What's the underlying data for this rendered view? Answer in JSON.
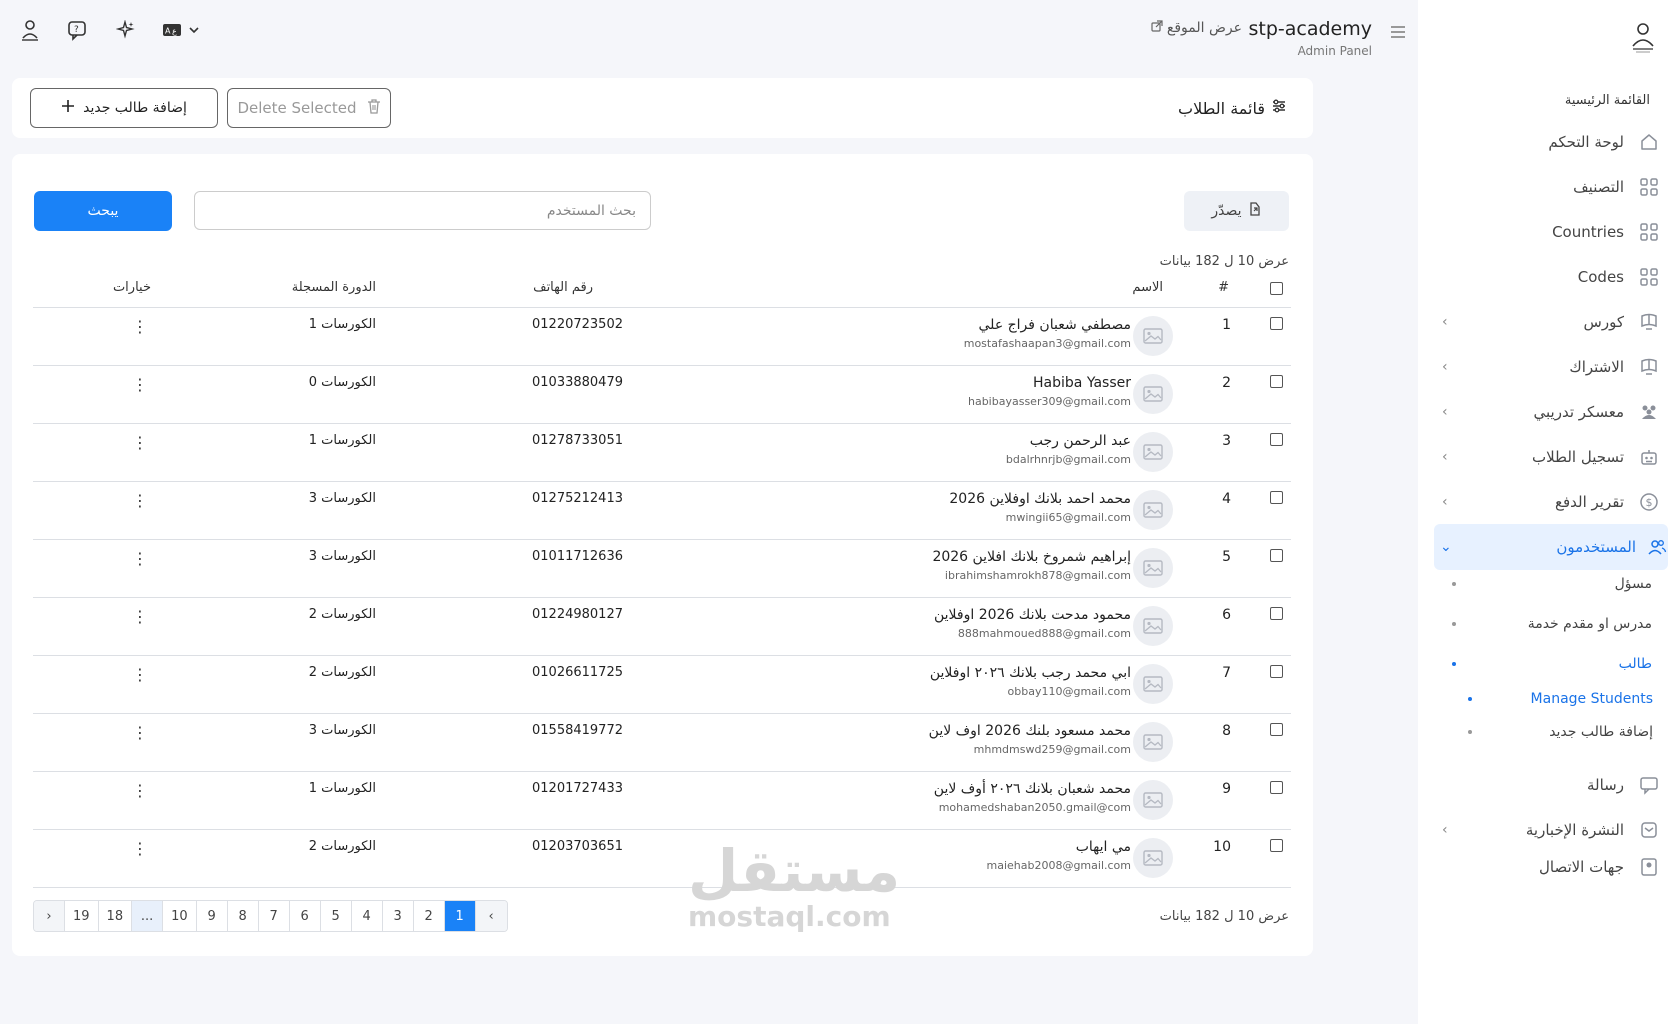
{
  "header": {
    "title": "stp-academy",
    "subtitle": "Admin Panel",
    "view_site": "عرض الموقع"
  },
  "sidebar": {
    "section_title": "القائمة الرئيسية",
    "items": [
      {
        "label": "لوحة التحكم",
        "icon": "home-icon"
      },
      {
        "label": "التصنيف",
        "icon": "grid-icon"
      },
      {
        "label": "Countries",
        "icon": "grid-icon"
      },
      {
        "label": "Codes",
        "icon": "grid-icon"
      },
      {
        "label": "كورس",
        "icon": "book-icon"
      },
      {
        "label": "الاشتراك",
        "icon": "book-icon"
      },
      {
        "label": "معسكر تدريبي",
        "icon": "group-icon"
      },
      {
        "label": "تسجيل الطلاب",
        "icon": "robot-icon"
      },
      {
        "label": "تقرير الدفع",
        "icon": "dollar-icon"
      },
      {
        "label": "المستخدمون",
        "icon": "users-icon"
      }
    ],
    "sub_items": [
      "مسؤل",
      "مدرس او مقدم خدمة",
      "طالب"
    ],
    "sub_sub_items": [
      "Manage Students",
      "إضافة طالب جديد"
    ],
    "items_after": [
      {
        "label": "رسالة",
        "icon": "chat-icon"
      },
      {
        "label": "النشرة الإخبارية",
        "icon": "newsletter-icon"
      },
      {
        "label": "جهات الاتصال",
        "icon": "contact-icon"
      }
    ]
  },
  "page": {
    "title": "قائمة الطلاب",
    "add_button": "إضافة طالب جديد",
    "delete_button": "Delete Selected",
    "export_button": "يصدّر",
    "search_placeholder": "بحث المستخدم",
    "search_button": "يبحث",
    "showing_text": "عرض 10 ل 182 بيانات"
  },
  "table": {
    "columns": [
      "#",
      "الاسم",
      "رقم الهاتف",
      "الدورة المسجلة",
      "خيارات"
    ],
    "rows": [
      {
        "num": "1",
        "name": "مصطفي شعبان فراج علي",
        "email": "mostafashaapan3@gmail.com",
        "phone": "01220723502",
        "courses": "1 الكورسات"
      },
      {
        "num": "2",
        "name": "Habiba Yasser",
        "email": "habibayasser309@gmail.com",
        "phone": "01033880479",
        "courses": "0 الكورسات"
      },
      {
        "num": "3",
        "name": "عبد الرحمن رجب",
        "email": "bdalrhnrjb@gmail.com",
        "phone": "01278733051",
        "courses": "1 الكورسات"
      },
      {
        "num": "4",
        "name": "محمد احمد بلانك اوفلاين 2026",
        "email": "mwingii65@gmail.com",
        "phone": "01275212413",
        "courses": "3 الكورسات"
      },
      {
        "num": "5",
        "name": "إبراهيم شمروخ بلانك افلاين 2026",
        "email": "ibrahimshamrokh878@gmail.com",
        "phone": "01011712636",
        "courses": "3 الكورسات"
      },
      {
        "num": "6",
        "name": "محمود مدحت بلانك 2026 اوفلاين",
        "email": "888mahmoued888@gmail.com",
        "phone": "01224980127",
        "courses": "2 الكورسات"
      },
      {
        "num": "7",
        "name": "ابي محمد رجب بلانك ٢٠٢٦ اوفلاين",
        "email": "obbay110@gmail.com",
        "phone": "01026611725",
        "courses": "2 الكورسات"
      },
      {
        "num": "8",
        "name": "محمد مسعود بلنك 2026 اوف لاين",
        "email": "mhmdmswd259@gmail.com",
        "phone": "01558419772",
        "courses": "3 الكورسات"
      },
      {
        "num": "9",
        "name": "محمد شعبان بلانك ٢٠٢٦ أوف لاين",
        "email": "mohamedshaban2050.gmail@com",
        "phone": "01201727433",
        "courses": "1 الكورسات"
      },
      {
        "num": "10",
        "name": "مي ايهاب",
        "email": "maiehab2008@gmail.com",
        "phone": "01203703651",
        "courses": "2 الكورسات"
      }
    ]
  },
  "pagination": {
    "pages": [
      "›",
      "19",
      "18",
      "...",
      "10",
      "9",
      "8",
      "7",
      "6",
      "5",
      "4",
      "3",
      "2",
      "1",
      "‹"
    ],
    "active": "1"
  },
  "watermark": {
    "line1": "مستقل",
    "line2": "mostaql.com"
  },
  "colors": {
    "accent": "#1a82f7",
    "active_bg": "#e7f1ff",
    "page_bg": "#f5f6fa"
  }
}
